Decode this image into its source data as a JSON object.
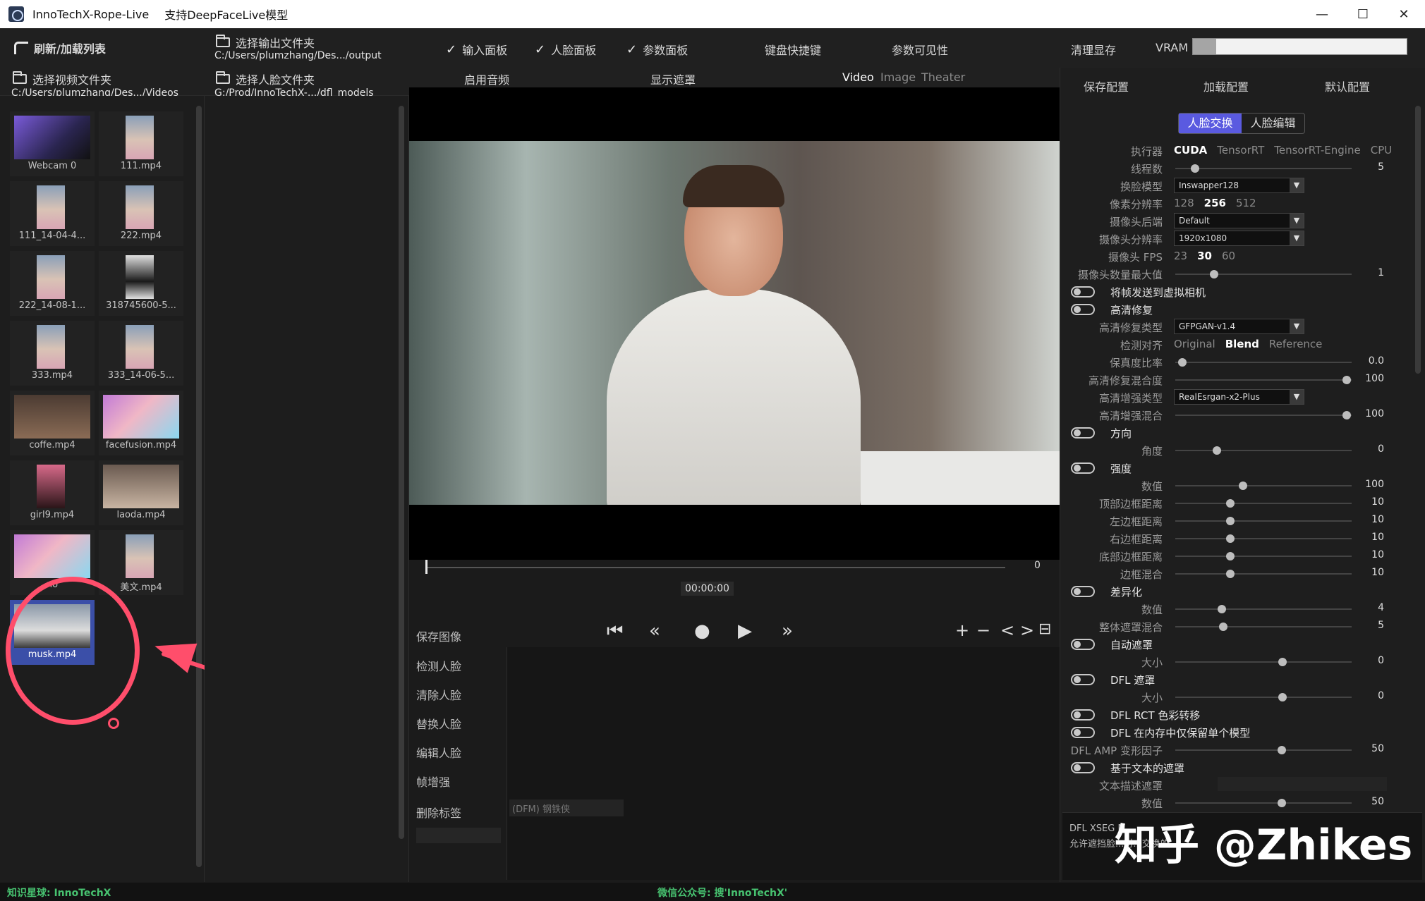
{
  "window": {
    "title": "InnoTechX-Rope-Live",
    "subtitle": "支持DeepFaceLive模型",
    "controls": {
      "minimize": "—",
      "maximize": "☐",
      "close": "✕"
    }
  },
  "toolbar": {
    "refresh_label": "刷新/加载列表",
    "select_output_label": "选择输出文件夹",
    "output_path": "C:/Users/plumzhang/Des.../output",
    "select_video_label": "选择视频文件夹",
    "video_path": "C:/Users/plumzhang/Des.../Videos",
    "select_face_label": "选择人脸文件夹",
    "face_path": "G:/Prod/InnoTechX-.../dfl_models",
    "input_panel": "输入面板",
    "face_panel": "人脸面板",
    "param_panel": "参数面板",
    "keyboard_shortcuts": "键盘快捷键",
    "param_visibility": "参数可见性",
    "clear_vram": "清理显存",
    "vram_label": "VRAM",
    "vram_used": 0.11,
    "enable_audio": "启用音频",
    "show_mask": "显示遮罩",
    "view_tabs": [
      "Video",
      "Image",
      "Theater"
    ],
    "active_view": "Video"
  },
  "thumbnails": [
    {
      "label": "Webcam 0"
    },
    {
      "label": "111.mp4"
    },
    {
      "label": "111_14-04-4..."
    },
    {
      "label": "222.mp4"
    },
    {
      "label": "222_14-08-1..."
    },
    {
      "label": "318745600-5..."
    },
    {
      "label": "333.mp4"
    },
    {
      "label": "333_14-06-5..."
    },
    {
      "label": "coffe.mp4"
    },
    {
      "label": "facefusion.mp4"
    },
    {
      "label": "girl9.mp4"
    },
    {
      "label": "laoda.mp4"
    },
    {
      "label": "no"
    },
    {
      "label": "美文.mp4"
    },
    {
      "label": "musk.mp4",
      "selected": true
    }
  ],
  "player": {
    "frame_number": "0",
    "time": "00:00:00",
    "save_image": "保存图像",
    "controls": [
      "⏮",
      "«",
      "●",
      "▶",
      "»"
    ],
    "tools": [
      "+",
      "−",
      "<",
      ">",
      "⊟"
    ]
  },
  "commands": [
    "检测人脸",
    "清除人脸",
    "替换人脸",
    "编辑人脸",
    "帧增强",
    "删除标签"
  ],
  "dfm_placeholder": "(DFM) 钢铁侠",
  "config": {
    "save": "保存配置",
    "load": "加载配置",
    "default": "默认配置",
    "mode_tabs": [
      "人脸交换",
      "人脸编辑"
    ],
    "active_mode": "人脸交换"
  },
  "params": {
    "executor_label": "执行器",
    "executor_opts": [
      "CUDA",
      "TensorRT",
      "TensorRT-Engine",
      "CPU"
    ],
    "threads_label": "线程数",
    "threads_val": "5",
    "swap_model_label": "换脸模型",
    "swap_model_val": "Inswapper128",
    "pixel_res_label": "像素分辨率",
    "pixel_res_opts": [
      "128",
      "256",
      "512"
    ],
    "cam_backend_label": "摄像头后端",
    "cam_backend_val": "Default",
    "cam_res_label": "摄像头分辨率",
    "cam_res_val": "1920x1080",
    "cam_fps_label": "摄像头 FPS",
    "cam_fps_opts": [
      "23",
      "30",
      "60"
    ],
    "cam_max_label": "摄像头数量最大值",
    "cam_max_val": "1",
    "send_virtual_cam": "将帧发送到虚拟相机",
    "hd_restore": "高清修复",
    "hd_type_label": "高清修复类型",
    "hd_type_val": "GFPGAN-v1.4",
    "detect_align_label": "检测对齐",
    "detect_align_opts": [
      "Original",
      "Blend",
      "Reference"
    ],
    "fidelity_label": "保真度比率",
    "fidelity_val": "0.0",
    "hd_blend_label": "高清修复混合度",
    "hd_blend_val": "100",
    "enhance_type_label": "高清增强类型",
    "enhance_type_val": "RealEsrgan-x2-Plus",
    "enhance_blend_label": "高清增强混合",
    "enhance_blend_val": "100",
    "orientation": "方向",
    "angle_label": "角度",
    "angle_val": "0",
    "strength": "强度",
    "strength_val_label": "数值",
    "strength_val": "100",
    "top_border_label": "顶部边框距离",
    "top_border_val": "10",
    "left_border_label": "左边框距离",
    "left_border_val": "10",
    "right_border_label": "右边框距离",
    "right_border_val": "10",
    "bottom_border_label": "底部边框距离",
    "bottom_border_val": "10",
    "border_blend_label": "边框混合",
    "border_blend_val": "10",
    "diff": "差异化",
    "diff_val_label": "数值",
    "diff_val": "4",
    "mask_blend_label": "整体遮罩混合",
    "mask_blend_val": "5",
    "auto_mask": "自动遮罩",
    "auto_size_label": "大小",
    "auto_size_val": "0",
    "dfl_mask": "DFL 遮罩",
    "dfl_size_label": "大小",
    "dfl_size_val": "0",
    "dfl_rct": "DFL RCT 色彩转移",
    "dfl_single": "DFL 在内存中仅保留单个模型",
    "dfl_amp_label": "DFL AMP 变形因子",
    "dfl_amp_val": "50",
    "text_mask": "基于文本的遮罩",
    "text_desc_label": "文本描述遮罩",
    "text_val_label": "数值",
    "text_val": "50"
  },
  "info": {
    "line1": "DFL XSEG M...",
    "line2": "允许遮挡脸...对...交换的..."
  },
  "watermark": "知乎 @Zhikes",
  "status": {
    "left": "知识星球: InnoTechX",
    "center": "微信公众号: 搜'InnoTechX'"
  },
  "colors": {
    "annotation": "#ff4e6b",
    "accent": "#5a5ae0",
    "status_green": "#47c270"
  }
}
